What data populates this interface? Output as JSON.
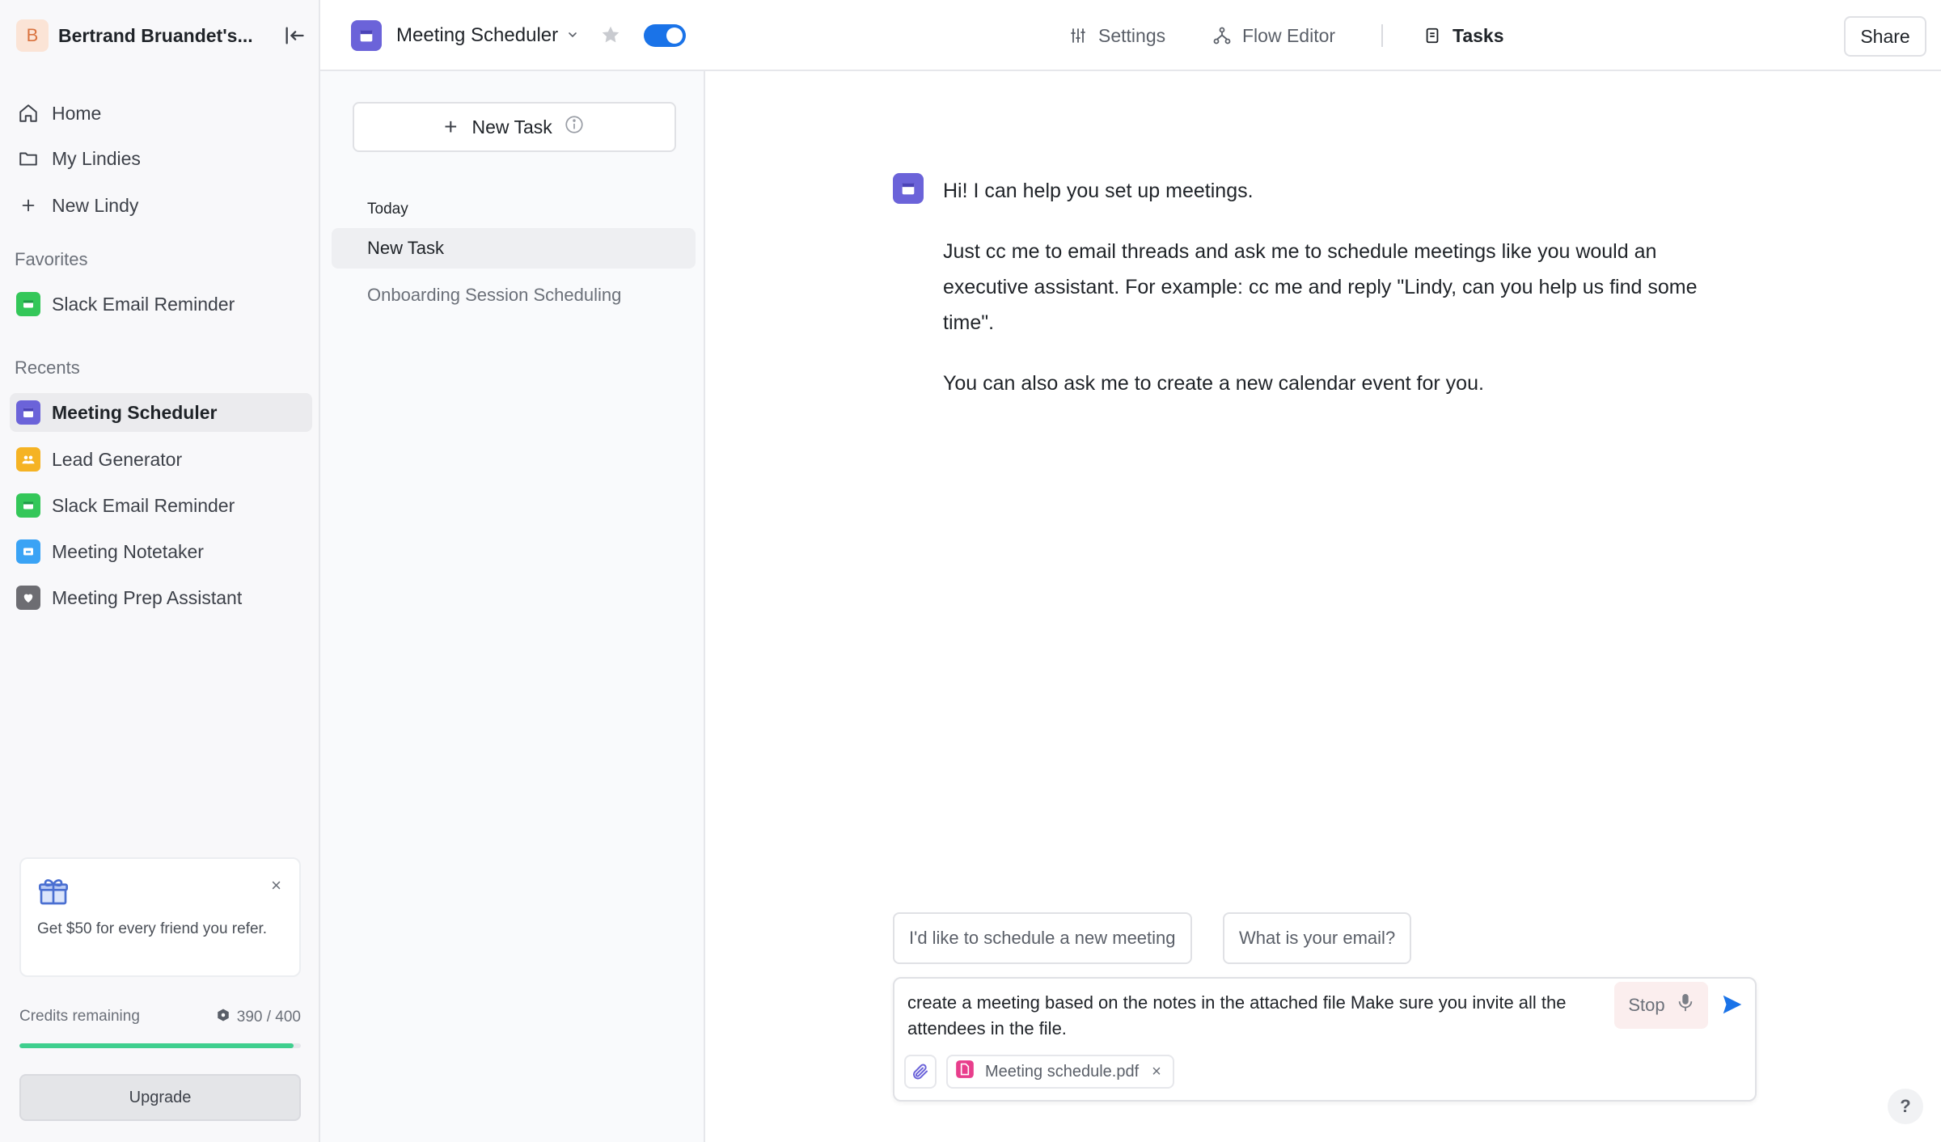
{
  "workspace": {
    "initial": "B",
    "name": "Bertrand Bruandet's..."
  },
  "nav": {
    "home": "Home",
    "my_lindies": "My Lindies",
    "new_lindy": "New Lindy"
  },
  "favorites": {
    "label": "Favorites",
    "items": [
      {
        "label": "Slack Email Reminder",
        "color": "#34c759"
      }
    ]
  },
  "recents": {
    "label": "Recents",
    "items": [
      {
        "label": "Meeting Scheduler",
        "color": "#6b63d9",
        "active": true
      },
      {
        "label": "Lead Generator",
        "color": "#f5b324"
      },
      {
        "label": "Slack Email Reminder",
        "color": "#34c759"
      },
      {
        "label": "Meeting Notetaker",
        "color": "#3aa3f5"
      },
      {
        "label": "Meeting Prep Assistant",
        "color": "#6d6d72"
      }
    ]
  },
  "referral": {
    "text": "Get $50 for every friend you refer.",
    "close": "×"
  },
  "credits": {
    "label": "Credits remaining",
    "value": "390 / 400",
    "used_fraction": 0.975
  },
  "upgrade": {
    "label": "Upgrade"
  },
  "topbar": {
    "agent_title": "Meeting Scheduler",
    "tabs": {
      "settings": "Settings",
      "flow_editor": "Flow Editor",
      "tasks": "Tasks"
    },
    "share": "Share",
    "toggle_on": true
  },
  "tasks_panel": {
    "new_task": "New Task",
    "today_label": "Today",
    "items": [
      {
        "label": "New Task",
        "active": true
      },
      {
        "label": "Onboarding Session Scheduling",
        "active": false
      }
    ]
  },
  "chat": {
    "message": {
      "p1": "Hi! I can help you set up meetings.",
      "p2": "Just cc me to email threads and ask me to schedule meetings like you would an executive assistant. For example: cc me and reply \"Lindy, can you help us find some time\".",
      "p3": "You can also ask me to create a new calendar event for you."
    },
    "suggestions": [
      "I'd like to schedule a new meeting",
      "What is your email?"
    ],
    "composer": {
      "text": "create a meeting based on the notes in the attached file Make sure you invite all the attendees in the file.",
      "stop": "Stop",
      "attachment": "Meeting schedule.pdf",
      "remove": "×"
    },
    "help": "?"
  },
  "colors": {
    "accent": "#1a73e8",
    "credits_bar": "#3fcf8e",
    "agent_purple": "#6b63d9"
  }
}
